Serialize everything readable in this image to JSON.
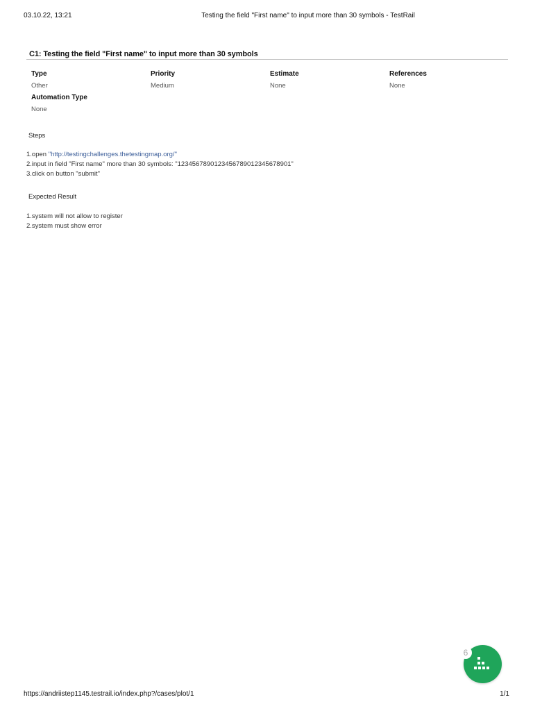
{
  "print_header": {
    "date": "03.10.22, 13:21",
    "title": "Testing the field \"First name\" to input more than 30 symbols - TestRail"
  },
  "case": {
    "title": "C1: Testing the field \"First name\" to input more than 30 symbols",
    "fields": {
      "type": {
        "label": "Type",
        "value": "Other"
      },
      "priority": {
        "label": "Priority",
        "value": "Medium"
      },
      "estimate": {
        "label": "Estimate",
        "value": "None"
      },
      "references": {
        "label": "References",
        "value": "None"
      },
      "automation_type": {
        "label": "Automation Type",
        "value": "None"
      }
    },
    "steps": {
      "label": "Steps",
      "line1_prefix": "1.open ",
      "line1_link": "\"http://testingchallenges.thetestingmap.org/\"",
      "line2": "2.input in field \"First name\" more than 30 symbols: \"1234567890123456789012345678901\"",
      "line3": "3.click on button \"submit\""
    },
    "expected": {
      "label": "Expected Result",
      "line1": "1.system will not allow to register",
      "line2": "2.system must show error"
    }
  },
  "widget": {
    "badge_count": "6",
    "icon": "dots-grid-icon",
    "color": "#1fa55a"
  },
  "print_footer": {
    "url": "https://andriistep1145.testrail.io/index.php?/cases/plot/1",
    "pages": "1/1"
  }
}
